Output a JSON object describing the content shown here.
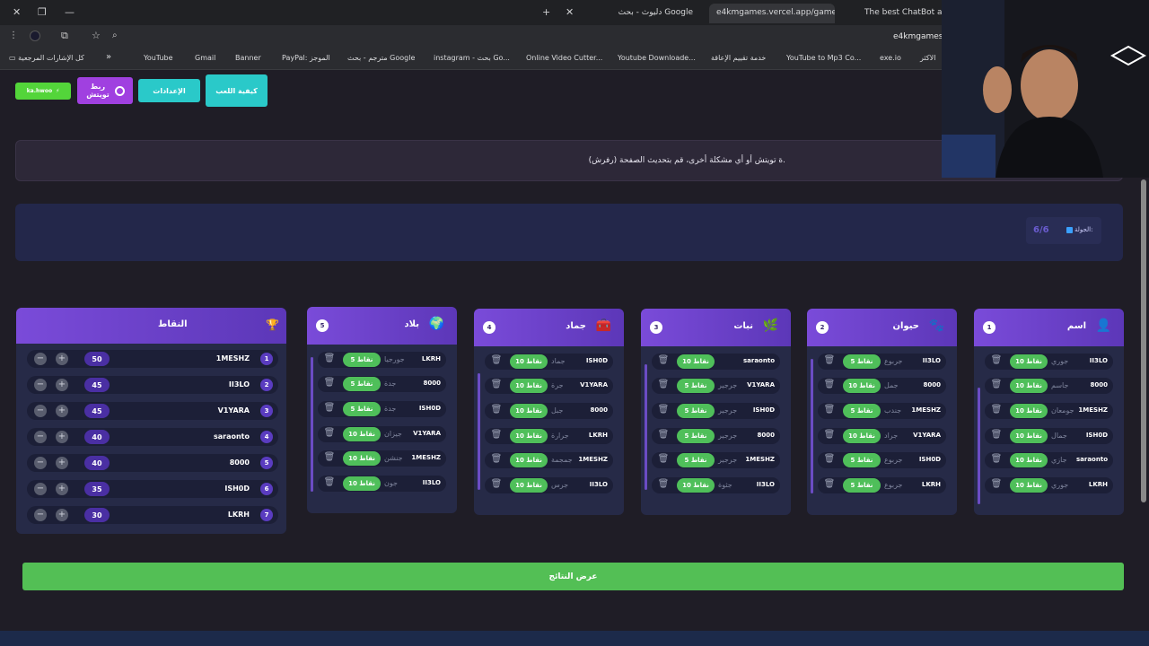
{
  "browser": {
    "tabs": [
      {
        "title": "The best ChatBot and Wi",
        "active": false
      },
      {
        "title": "e4kmgames.vercel.app/games/",
        "active": true
      },
      {
        "title": "دليوث - بحث Google",
        "active": false
      }
    ],
    "address": "e4kmgames.v",
    "bookmarks": [
      "الاكثر",
      "exe.io",
      "YouTube to Mp3 Co...",
      "خدمة تقييم الإعاقة",
      "Youtube Downloade...",
      "Online Video Cutter...",
      "instagram - بحث Go...",
      "مترجم - بحث Google",
      "PayPal: الموجز",
      "Banner",
      "Gmail",
      "YouTube"
    ],
    "bookmarks_folder": "كل الإشارات المرجعية",
    "more_symbol": "»"
  },
  "top_buttons": {
    "how_to_play": "كيفية اللعب",
    "settings": "الإعدادات",
    "connect_twitch": "ربط تويتش",
    "kick": "ka.hwoo"
  },
  "notice": "ة تويتش أو أي مشكلة أخرى، قم بتحديث الصفحة (رفرش).",
  "round": {
    "label": "الجولة:",
    "value": "6/6"
  },
  "categories": [
    {
      "num": "1",
      "title": "اسم",
      "icon": "person-icon",
      "rows": [
        {
          "pts": "10 نقاط",
          "ans": "جوري",
          "player": "II3LO"
        },
        {
          "pts": "10 نقاط",
          "ans": "جاسم",
          "player": "8000"
        },
        {
          "pts": "10 نقاط",
          "ans": "جومعان",
          "player": "1MESHZ"
        },
        {
          "pts": "10 نقاط",
          "ans": "جمال",
          "player": "ISH0D"
        },
        {
          "pts": "10 نقاط",
          "ans": "جازي",
          "player": "saraonto"
        },
        {
          "pts": "10 نقاط",
          "ans": "جوري",
          "player": "LKRH"
        }
      ]
    },
    {
      "num": "2",
      "title": "حيوان",
      "icon": "paw-icon",
      "rows": [
        {
          "pts": "5 نقاط",
          "ans": "جربوع",
          "player": "II3LO"
        },
        {
          "pts": "10 نقاط",
          "ans": "جمل",
          "player": "8000"
        },
        {
          "pts": "5 نقاط",
          "ans": "جندب",
          "player": "1MESHZ"
        },
        {
          "pts": "10 نقاط",
          "ans": "جراد",
          "player": "V1YARA"
        },
        {
          "pts": "5 نقاط",
          "ans": "جربوع",
          "player": "ISH0D"
        },
        {
          "pts": "5 نقاط",
          "ans": "جربوع",
          "player": "LKRH"
        }
      ]
    },
    {
      "num": "3",
      "title": "نبات",
      "icon": "leaf-icon",
      "rows": [
        {
          "pts": "10 نقاط",
          "ans": "",
          "player": "saraonto"
        },
        {
          "pts": "5 نقاط",
          "ans": "جرجير",
          "player": "V1YARA"
        },
        {
          "pts": "5 نقاط",
          "ans": "جرجير",
          "player": "ISH0D"
        },
        {
          "pts": "5 نقاط",
          "ans": "جرجير",
          "player": "8000"
        },
        {
          "pts": "5 نقاط",
          "ans": "جرجير",
          "player": "1MESHZ"
        },
        {
          "pts": "10 نقاط",
          "ans": "جثوة",
          "player": "II3LO"
        }
      ]
    },
    {
      "num": "4",
      "title": "جماد",
      "icon": "toolbox-icon",
      "rows": [
        {
          "pts": "10 نقاط",
          "ans": "جماد",
          "player": "ISH0D"
        },
        {
          "pts": "10 نقاط",
          "ans": "جرة",
          "player": "V1YARA"
        },
        {
          "pts": "10 نقاط",
          "ans": "جبل",
          "player": "8000"
        },
        {
          "pts": "10 نقاط",
          "ans": "جرارة",
          "player": "LKRH"
        },
        {
          "pts": "10 نقاط",
          "ans": "جمجمة",
          "player": "1MESHZ"
        },
        {
          "pts": "10 نقاط",
          "ans": "جرس",
          "player": "II3LO"
        }
      ]
    },
    {
      "num": "5",
      "title": "بلاد",
      "icon": "globe-icon",
      "rows": [
        {
          "pts": "5 نقاط",
          "ans": "جورجيا",
          "player": "LKRH"
        },
        {
          "pts": "5 نقاط",
          "ans": "جدة",
          "player": "8000"
        },
        {
          "pts": "5 نقاط",
          "ans": "جدة",
          "player": "ISH0D"
        },
        {
          "pts": "10 نقاط",
          "ans": "جيزان",
          "player": "V1YARA"
        },
        {
          "pts": "10 نقاط",
          "ans": "جنشن",
          "player": "1MESHZ"
        },
        {
          "pts": "10 نقاط",
          "ans": "جون",
          "player": "II3LO"
        }
      ]
    }
  ],
  "scores": {
    "title": "النقاط",
    "rows": [
      {
        "rank": "1",
        "name": "1MESHZ",
        "value": "50"
      },
      {
        "rank": "2",
        "name": "II3LO",
        "value": "45"
      },
      {
        "rank": "3",
        "name": "V1YARA",
        "value": "45"
      },
      {
        "rank": "4",
        "name": "saraonto",
        "value": "40"
      },
      {
        "rank": "5",
        "name": "8000",
        "value": "40"
      },
      {
        "rank": "6",
        "name": "ISH0D",
        "value": "35"
      },
      {
        "rank": "7",
        "name": "LKRH",
        "value": "30"
      }
    ]
  },
  "show_results": "عرض النتائج",
  "colors": {
    "accent": "#7a4bd9",
    "green": "#4fbf5a",
    "teal": "#2ac9c9",
    "purple": "#a040e0"
  }
}
